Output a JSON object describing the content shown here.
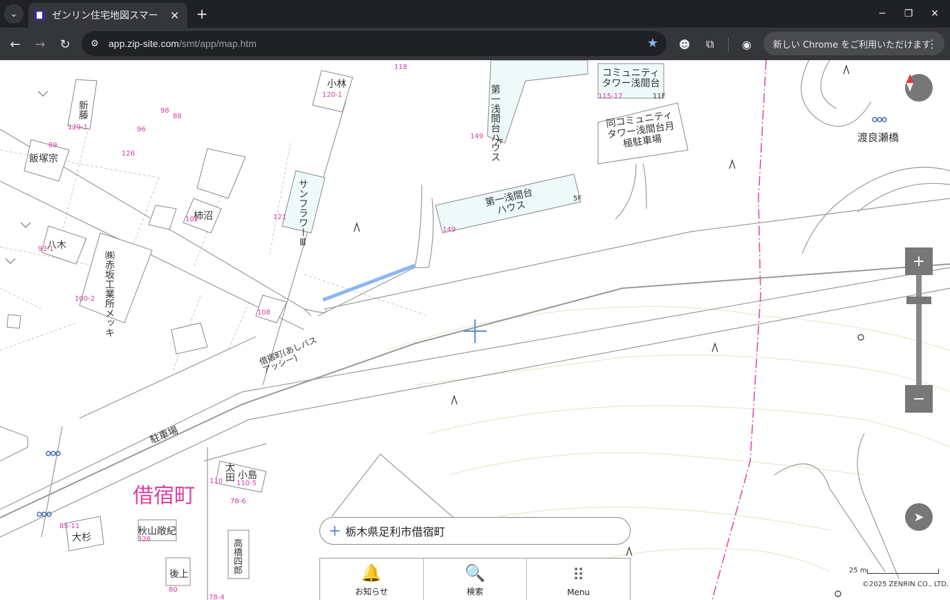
{
  "browser": {
    "tab_title": "ゼンリン住宅地図スマー",
    "url_host": "app.zip-site.com",
    "url_path": "/smt/app/map.htm",
    "update_chip": "新しい Chrome をご利用いただけます"
  },
  "map": {
    "town_name": "借宿町",
    "labels": {
      "kobayashi": "小林",
      "kobayashi_num": "120-1",
      "shinfuji": "新藤",
      "shinfuji_num": "129-1",
      "iitsuka": "飯塚宗",
      "iitsuka_num": "89",
      "yagi": "八木",
      "yagi_num": "93-1",
      "akasaka": "㈱赤坂工業所メッキ",
      "akasaka_num": "100-2",
      "kakinuma": "柿沼",
      "kakinuma_num": "102",
      "sunflower": "サンフラワーⅢ",
      "sunflower_num": "121",
      "daiichi_house_vert": "第一浅間台ハウス",
      "daiichi_house_vert_num": "149",
      "daiichi_house_vert_floor": "7F",
      "daiichi_house": "第一浅間台ハウス",
      "daiichi_house_num": "149",
      "daiichi_house_floor": "5F",
      "community_tower": "コミュニティタワー浅間台",
      "community_tower_num": "115-17",
      "community_tower_floor": "11F",
      "parking_tower": "同コミュニティタワー浅間台月極駐車場",
      "watarase_bridge": "渡良瀬橋",
      "bus_stop": "借宿町(あしバスアッシー)",
      "parking": "駐車場",
      "ota": "太田",
      "ota_num": "110",
      "kojima": "小島",
      "kojima_num": "110-5",
      "sugi": "大杉",
      "sugi_num": "85-11",
      "akiyama": "秋山敞紀",
      "akiyama_num": "326",
      "gotou": "後上",
      "takahashi": "高橋四郎",
      "num_118": "118",
      "num_98": "98",
      "num_88": "88",
      "num_96": "96",
      "num_126": "126",
      "num_108": "108",
      "num_78_6": "78-6",
      "num_78_4": "78-4",
      "num_80": "80"
    },
    "address": "栃木県足利市借宿町",
    "menu": [
      {
        "label": "お知らせ",
        "icon": "bell-icon"
      },
      {
        "label": "検索",
        "icon": "search-icon"
      },
      {
        "label": "Menu",
        "icon": "grid-icon"
      }
    ],
    "scale": "25 m",
    "copyright": "©2025 ZENRIN CO., LTD.",
    "colors": {
      "town": "#e040a0",
      "boundary": "#e040a0",
      "water": "#8ab8f0",
      "building_fill": "#eefafa"
    }
  }
}
